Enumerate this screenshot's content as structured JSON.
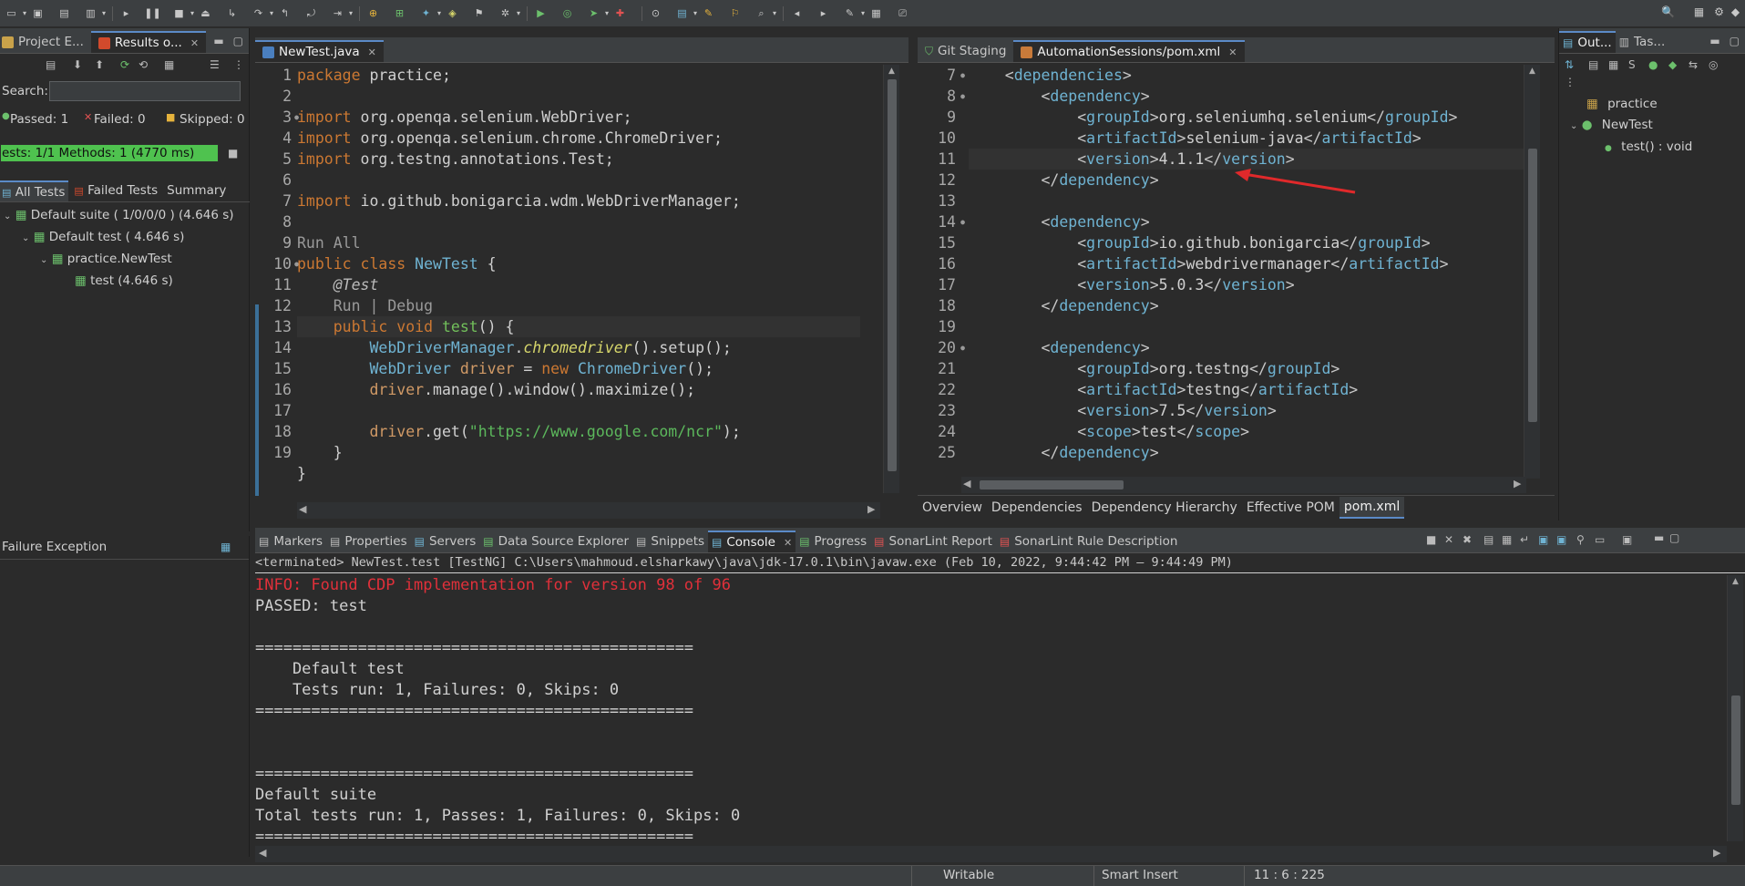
{
  "toolbar": {
    "icons": [
      "new-icon",
      "save-icon",
      "save-all-icon",
      "print-icon",
      "skip-icon",
      "resume-icon",
      "suspend-icon",
      "terminate-icon",
      "disconnect-icon",
      "step-into-icon",
      "step-over-icon",
      "step-return-icon",
      "drop-to-frame-icon",
      "use-step-filters-icon",
      "new-java-project-icon",
      "new-package-icon",
      "new-class-icon",
      "open-type-icon",
      "task-icon",
      "debug-icon",
      "run-icon",
      "coverage-icon",
      "external-tools-icon",
      "new-wizard-icon",
      "web-icon",
      "open-folder-icon",
      "annotation-icon",
      "pin-icon",
      "search-icon",
      "perspective-icon",
      "back-icon",
      "forward-icon",
      "edit-icon"
    ]
  },
  "left_panel": {
    "tabs": [
      {
        "label": "Project E...",
        "icon": "package-explorer-icon"
      },
      {
        "label": "Results o...",
        "icon": "testng-icon",
        "active": true
      }
    ],
    "search_label": "Search:",
    "search_value": "",
    "counters": {
      "passed": "Passed: 1",
      "failed": "Failed: 0",
      "skipped": "Skipped: 0"
    },
    "progress_text": "ests: 1/1  Methods: 1 (4770 ms)",
    "progress_fraction": 1.0,
    "result_tabs": [
      "All Tests",
      "Failed Tests",
      "Summary"
    ],
    "tree": [
      {
        "label": "Default suite ( 1/0/0/0 ) (4.646 s)",
        "level": 0
      },
      {
        "label": "Default test ( 4.646 s)",
        "level": 1
      },
      {
        "label": "practice.NewTest",
        "level": 2
      },
      {
        "label": "test  (4.646 s)",
        "level": 3
      }
    ],
    "failure_title": "Failure Exception"
  },
  "editor_left": {
    "tab": "NewTest.java",
    "lines": [
      {
        "n": "1",
        "html": "<span class='kw'>package</span> practice;"
      },
      {
        "n": "2",
        "html": ""
      },
      {
        "n": "3",
        "html": "<span class='kw'>import</span> org.openqa.selenium.WebDriver;",
        "fold": true
      },
      {
        "n": "4",
        "html": "<span class='kw'>import</span> org.openqa.selenium.chrome.ChromeDriver;"
      },
      {
        "n": "5",
        "html": "<span class='kw'>import</span> org.testng.annotations.Test;"
      },
      {
        "n": "6",
        "html": ""
      },
      {
        "n": "7",
        "html": "<span class='kw'>import</span> io.github.bonigarcia.wdm.WebDriverManager;"
      },
      {
        "n": "8",
        "html": ""
      },
      {
        "n": "",
        "html": "<span class='lens'>Run All</span>"
      },
      {
        "n": "9",
        "html": "<span class='kw'>public class</span> <span class='cls'>NewTest</span> {"
      },
      {
        "n": "10",
        "html": "    <span class='ann'>@Test</span>",
        "fold": true
      },
      {
        "n": "",
        "html": "    <span class='lens'>Run | Debug</span>"
      },
      {
        "n": "11",
        "html": "    <span class='kw'>public void</span> <span class='meth'>test</span>() {",
        "current": true
      },
      {
        "n": "12",
        "html": "        <span class='cls'>WebDriverManager</span>.<span class='smeth'>chromedriver</span>().setup();"
      },
      {
        "n": "13",
        "html": "        <span class='cls'>WebDriver</span> <span class='kw2'>driver</span> = <span class='kw'>new</span> <span class='cls'>ChromeDriver</span>();"
      },
      {
        "n": "14",
        "html": "        <span class='kw2'>driver</span>.manage().window().maximize();"
      },
      {
        "n": "15",
        "html": ""
      },
      {
        "n": "16",
        "html": "        <span class='kw2'>driver</span>.get(<span class='str'>\"https://www.google.com/ncr\"</span>);"
      },
      {
        "n": "17",
        "html": "    }"
      },
      {
        "n": "18",
        "html": "}"
      },
      {
        "n": "19",
        "html": ""
      }
    ]
  },
  "editor_right": {
    "tabs": [
      {
        "label": "Git Staging",
        "icon": "git-staging-icon"
      },
      {
        "label": "AutomationSessions/pom.xml",
        "icon": "xml-file-icon",
        "active": true
      }
    ],
    "lines": [
      {
        "n": "7",
        "fold": true,
        "html": "    <span class='br'>&lt;</span><span class='tag'>dependencies</span><span class='br'>&gt;</span>"
      },
      {
        "n": "8",
        "fold": true,
        "html": "        <span class='br'>&lt;</span><span class='tag'>dependency</span><span class='br'>&gt;</span>"
      },
      {
        "n": "9",
        "html": "            <span class='br'>&lt;</span><span class='tag'>groupId</span><span class='br'>&gt;</span>org.seleniumhq.selenium<span class='br'>&lt;/</span><span class='tag'>groupId</span><span class='br'>&gt;</span>"
      },
      {
        "n": "10",
        "html": "            <span class='br'>&lt;</span><span class='tag'>artifactId</span><span class='br'>&gt;</span>selenium-java<span class='br'>&lt;/</span><span class='tag'>artifactId</span><span class='br'>&gt;</span>"
      },
      {
        "n": "11",
        "current": true,
        "html": "            <span class='br'>&lt;</span><span class='tag'>version</span><span class='br'>&gt;</span>4.1.1<span class='br'>&lt;/</span><span class='tag'>version</span><span class='br'>&gt;</span>"
      },
      {
        "n": "12",
        "html": "        <span class='br'>&lt;/</span><span class='tag'>dependency</span><span class='br'>&gt;</span>"
      },
      {
        "n": "13",
        "html": ""
      },
      {
        "n": "14",
        "fold": true,
        "html": "        <span class='br'>&lt;</span><span class='tag'>dependency</span><span class='br'>&gt;</span>"
      },
      {
        "n": "15",
        "html": "            <span class='br'>&lt;</span><span class='tag'>groupId</span><span class='br'>&gt;</span>io.github.bonigarcia<span class='br'>&lt;/</span><span class='tag'>groupId</span><span class='br'>&gt;</span>"
      },
      {
        "n": "16",
        "html": "            <span class='br'>&lt;</span><span class='tag'>artifactId</span><span class='br'>&gt;</span>webdrivermanager<span class='br'>&lt;/</span><span class='tag'>artifactId</span><span class='br'>&gt;</span>"
      },
      {
        "n": "17",
        "html": "            <span class='br'>&lt;</span><span class='tag'>version</span><span class='br'>&gt;</span>5.0.3<span class='br'>&lt;/</span><span class='tag'>version</span><span class='br'>&gt;</span>"
      },
      {
        "n": "18",
        "html": "        <span class='br'>&lt;/</span><span class='tag'>dependency</span><span class='br'>&gt;</span>"
      },
      {
        "n": "19",
        "html": ""
      },
      {
        "n": "20",
        "fold": true,
        "html": "        <span class='br'>&lt;</span><span class='tag'>dependency</span><span class='br'>&gt;</span>"
      },
      {
        "n": "21",
        "html": "            <span class='br'>&lt;</span><span class='tag'>groupId</span><span class='br'>&gt;</span>org.testng<span class='br'>&lt;/</span><span class='tag'>groupId</span><span class='br'>&gt;</span>"
      },
      {
        "n": "22",
        "html": "            <span class='br'>&lt;</span><span class='tag'>artifactId</span><span class='br'>&gt;</span>testng<span class='br'>&lt;/</span><span class='tag'>artifactId</span><span class='br'>&gt;</span>"
      },
      {
        "n": "23",
        "html": "            <span class='br'>&lt;</span><span class='tag'>version</span><span class='br'>&gt;</span>7.5<span class='br'>&lt;/</span><span class='tag'>version</span><span class='br'>&gt;</span>"
      },
      {
        "n": "24",
        "html": "            <span class='br'>&lt;</span><span class='tag'>scope</span><span class='br'>&gt;</span>test<span class='br'>&lt;/</span><span class='tag'>scope</span><span class='br'>&gt;</span>"
      },
      {
        "n": "25",
        "html": "        <span class='br'>&lt;/</span><span class='tag'>dependency</span><span class='br'>&gt;</span>"
      }
    ],
    "bottom_tabs": [
      {
        "label": "Overview"
      },
      {
        "label": "Dependencies"
      },
      {
        "label": "Dependency Hierarchy"
      },
      {
        "label": "Effective POM"
      },
      {
        "label": "pom.xml",
        "active": true
      }
    ],
    "arrow_color": "#e0292b"
  },
  "outline": {
    "tabs": [
      {
        "label": "Out...",
        "icon": "outline-icon",
        "active": true
      },
      {
        "label": "Tas...",
        "icon": "task-list-icon"
      }
    ],
    "tree": [
      {
        "label": "practice",
        "level": 0,
        "icon": "package-icon"
      },
      {
        "label": "NewTest",
        "level": 0,
        "icon": "class-icon"
      },
      {
        "label": "test() : void",
        "level": 1,
        "icon": "method-icon"
      }
    ]
  },
  "console": {
    "tabs": [
      {
        "label": "Markers",
        "icon": "markers-icon"
      },
      {
        "label": "Properties",
        "icon": "properties-icon"
      },
      {
        "label": "Servers",
        "icon": "servers-icon"
      },
      {
        "label": "Data Source Explorer",
        "icon": "data-source-icon"
      },
      {
        "label": "Snippets",
        "icon": "snippets-icon"
      },
      {
        "label": "Console",
        "icon": "console-icon",
        "active": true
      },
      {
        "label": "Progress",
        "icon": "progress-icon"
      },
      {
        "label": "SonarLint Report",
        "icon": "sonarlint-icon"
      },
      {
        "label": "SonarLint Rule Description",
        "icon": "sonarlint-rule-icon"
      }
    ],
    "header": "<terminated> NewTest.test [TestNG] C:\\Users\\mahmoud.elsharkawy\\java\\jdk-17.0.1\\bin\\javaw.exe  (Feb 10, 2022, 9:44:42 PM – 9:44:49 PM)",
    "lines": [
      {
        "text": "INFO: Found CDP implementation for version 98 of 96",
        "color": "#e0303a"
      },
      {
        "text": "PASSED: test"
      },
      {
        "text": ""
      },
      {
        "text": "==============================================="
      },
      {
        "text": "    Default test"
      },
      {
        "text": "    Tests run: 1, Failures: 0, Skips: 0"
      },
      {
        "text": "==============================================="
      },
      {
        "text": ""
      },
      {
        "text": ""
      },
      {
        "text": "==============================================="
      },
      {
        "text": "Default suite"
      },
      {
        "text": "Total tests run: 1, Passes: 1, Failures: 0, Skips: 0"
      },
      {
        "text": "==============================================="
      }
    ]
  },
  "status": {
    "writable": "Writable",
    "insert_mode": "Smart Insert",
    "position": "11 : 6 : 225"
  },
  "colors": {
    "progress_green": "#4fc24f",
    "accent": "#5b8ac7"
  }
}
